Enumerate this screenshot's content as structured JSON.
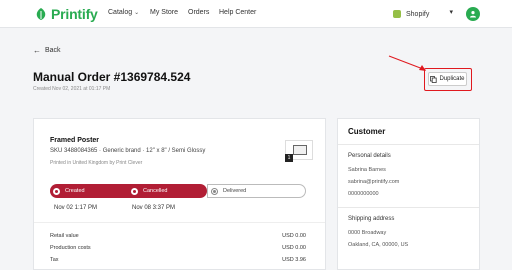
{
  "header": {
    "logo_text": "Printify",
    "nav": [
      {
        "label": "Catalog",
        "has_dropdown": true
      },
      {
        "label": "My Store"
      },
      {
        "label": "Orders"
      },
      {
        "label": "Help Center"
      }
    ],
    "store": "Shopify"
  },
  "back_label": "Back",
  "order": {
    "title": "Manual Order #1369784.524",
    "created": "Created Nov 02, 2021 at 01:17 PM",
    "duplicate_label": "Duplicate"
  },
  "product": {
    "name": "Framed Poster",
    "sku_line": "SKU 3488084365 · Generic brand · 12\" x 8\" / Semi Glossy",
    "printed_in": "Printed in United Kingdom by Print Clever",
    "quantity": "1"
  },
  "status": {
    "steps": [
      {
        "label": "Created",
        "date": "Nov 02 1:17 PM",
        "state": "done"
      },
      {
        "label": "Cancelled",
        "date": "Nov 08 3:37 PM",
        "state": "done"
      },
      {
        "label": "Delivered",
        "date": "",
        "state": "pending"
      }
    ],
    "color_active": "#b11e35"
  },
  "financials": [
    {
      "label": "Retail value",
      "value": "USD 0.00"
    },
    {
      "label": "Production costs",
      "value": "USD 0.00"
    },
    {
      "label": "Tax",
      "value": "USD 3.96"
    }
  ],
  "customer": {
    "title": "Customer",
    "personal_heading": "Personal details",
    "name": "Sabrina Barnes",
    "email": "sabrina@printify.com",
    "phone": "0000000000",
    "shipping_heading": "Shipping address",
    "address1": "0000 Broadway",
    "address2": "Oakland, CA, 00000, US"
  },
  "colors": {
    "brand": "#29ab51",
    "annotation": "#e0191f"
  }
}
